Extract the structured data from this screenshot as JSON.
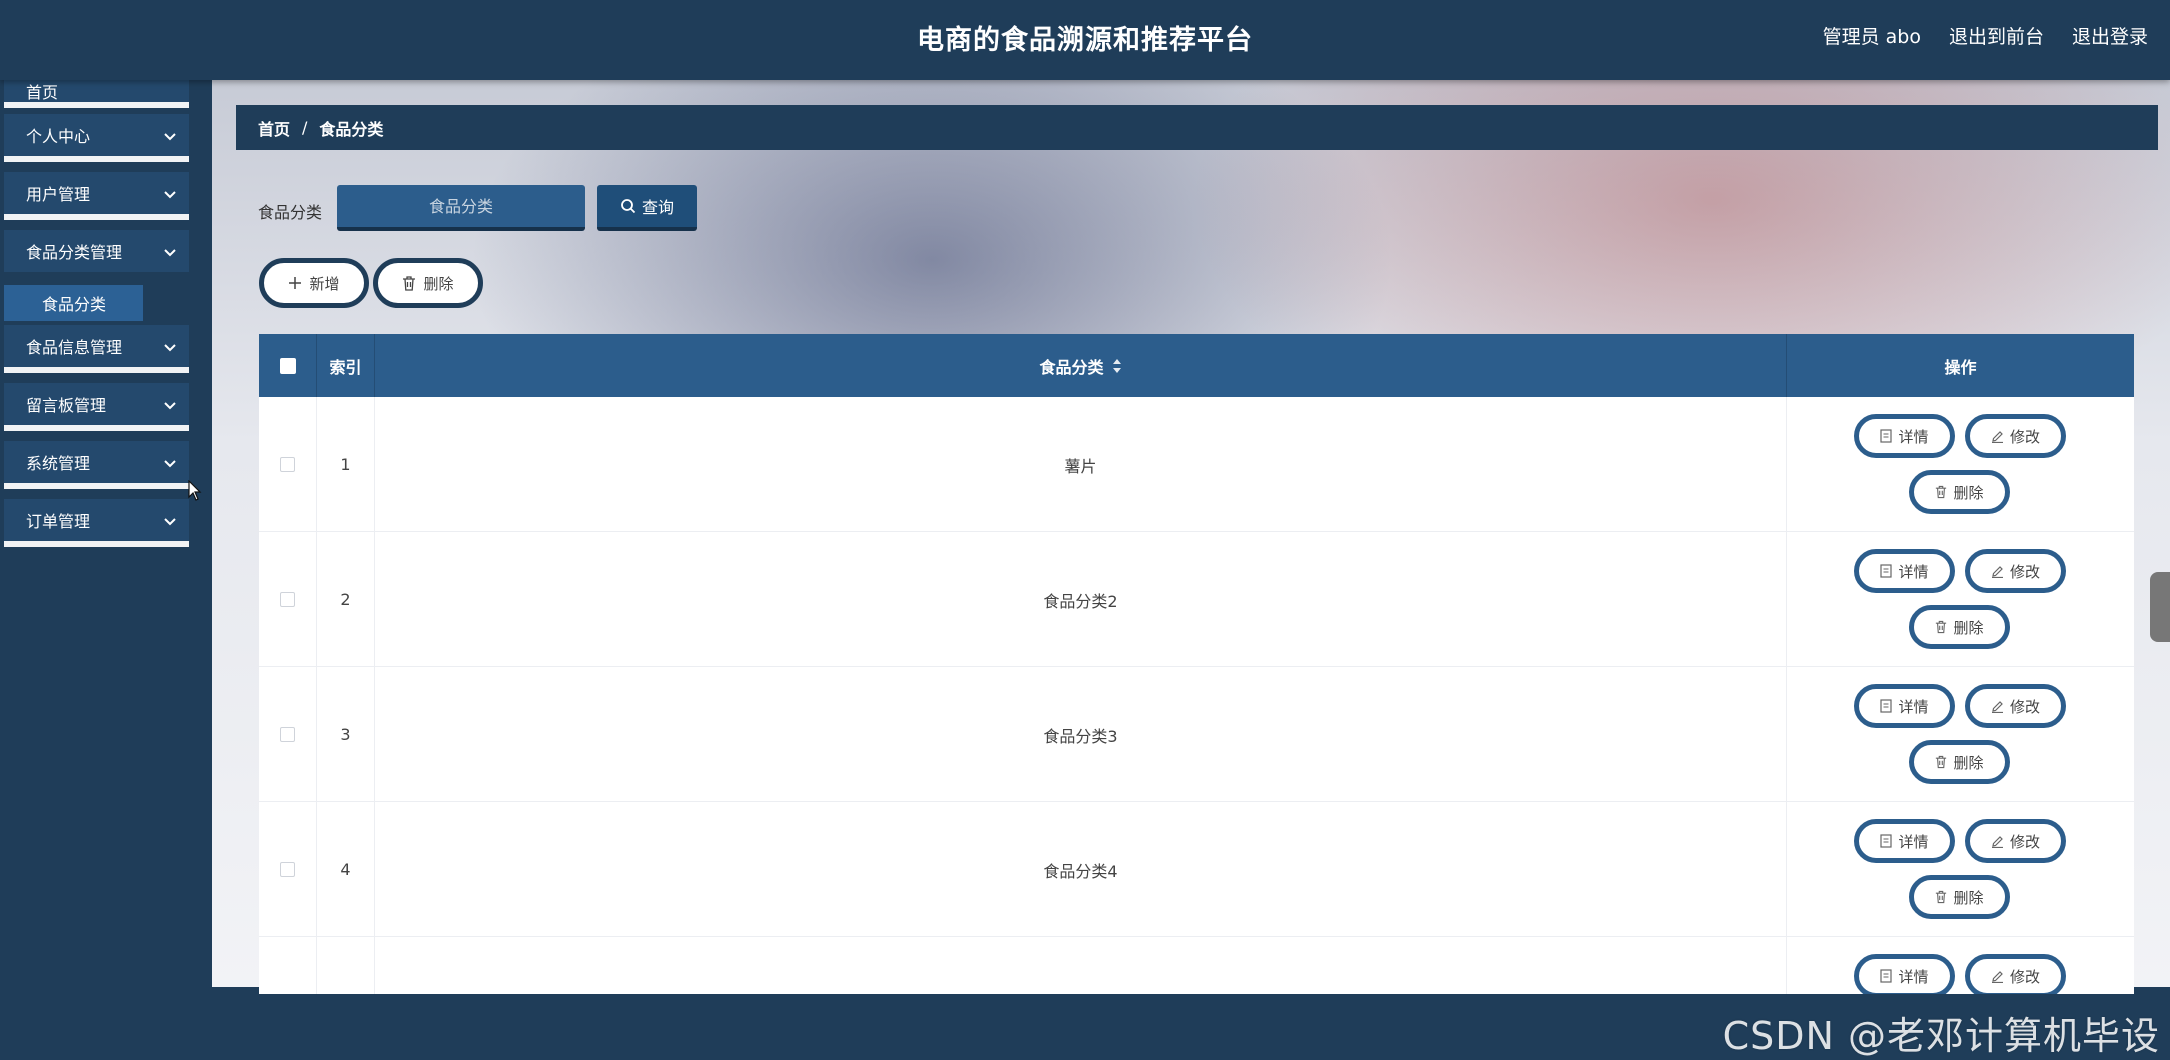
{
  "header": {
    "title": "电商的食品溯源和推荐平台",
    "admin_label": "管理员 abo",
    "front_link": "退出到前台",
    "logout_link": "退出登录"
  },
  "sidebar": {
    "items": [
      {
        "label": "首页"
      },
      {
        "label": "个人中心"
      },
      {
        "label": "用户管理"
      },
      {
        "label": "食品分类管理"
      },
      {
        "label": "食品信息管理"
      },
      {
        "label": "留言板管理"
      },
      {
        "label": "系统管理"
      },
      {
        "label": "订单管理"
      }
    ],
    "active_sub": "食品分类"
  },
  "breadcrumb": {
    "home": "首页",
    "separator": "/",
    "current": "食品分类"
  },
  "search": {
    "label": "食品分类",
    "placeholder": "食品分类",
    "button": "查询"
  },
  "toolbar": {
    "add_label": "新增",
    "delete_label": "删除"
  },
  "table": {
    "columns": {
      "index": "索引",
      "category": "食品分类",
      "actions": "操作"
    },
    "rows": [
      {
        "index": "1",
        "category": "薯片"
      },
      {
        "index": "2",
        "category": "食品分类2"
      },
      {
        "index": "3",
        "category": "食品分类3"
      },
      {
        "index": "4",
        "category": "食品分类4"
      },
      {
        "index": "",
        "category": ""
      }
    ],
    "action_labels": {
      "detail": "详情",
      "edit": "修改",
      "delete": "删除"
    }
  },
  "watermark": "CSDN @老邓计算机毕设",
  "colors": {
    "header_bg": "#1f3d59",
    "table_head": "#2c5d8c",
    "active_sub": "#2c6195"
  }
}
